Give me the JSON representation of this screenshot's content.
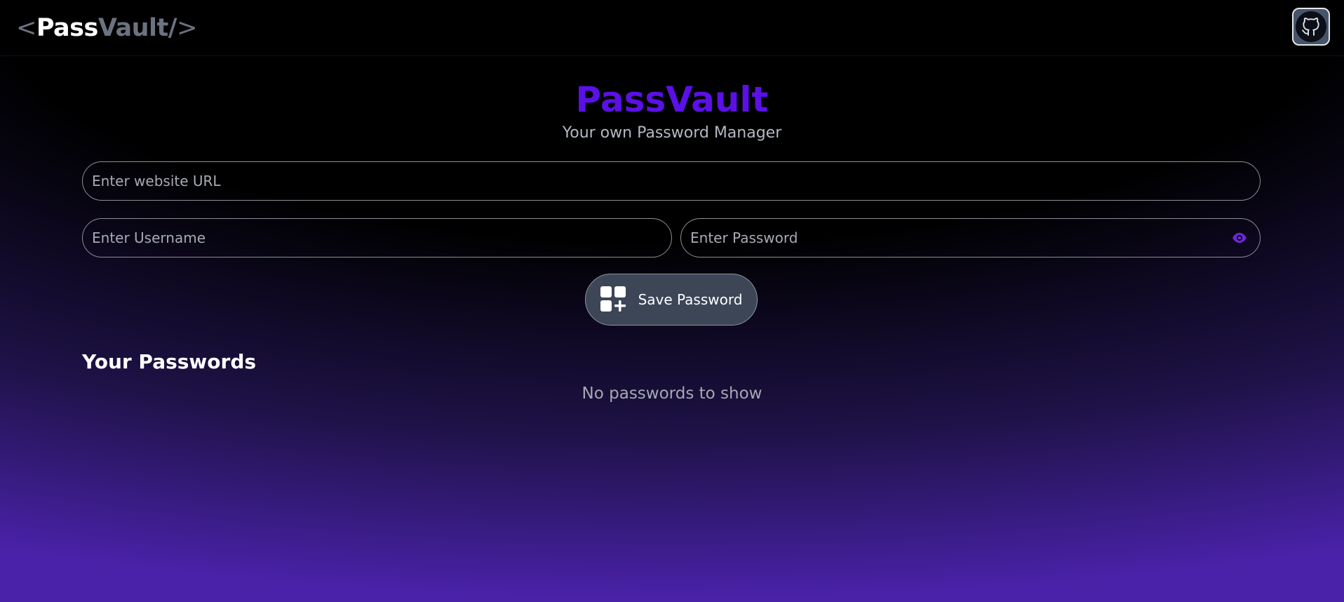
{
  "header": {
    "logo": {
      "open": "<",
      "pass": "Pass",
      "vault": "Vault/",
      "close": ">"
    },
    "github_icon": "github-icon"
  },
  "hero": {
    "title": "PassVault",
    "subtitle": "Your own Password Manager"
  },
  "form": {
    "url_placeholder": "Enter website URL",
    "url_value": "",
    "username_placeholder": "Enter Username",
    "username_value": "",
    "password_placeholder": "Enter Password",
    "password_value": "",
    "eye_icon": "eye-icon",
    "save_label": "Save Password",
    "save_icon": "grid-plus-icon"
  },
  "passwords": {
    "heading": "Your Passwords",
    "empty_text": "No passwords to show"
  },
  "colors": {
    "brand": "#5b10e6",
    "eye": "#6d28d9",
    "button_bg": "#3c4657"
  }
}
